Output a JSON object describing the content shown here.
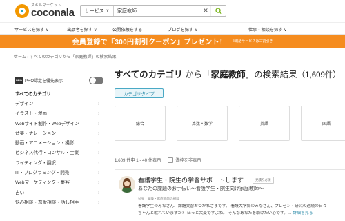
{
  "header": {
    "logo_sub": "スキルマーケット",
    "logo_main": "coconala",
    "search": {
      "category": "サービス",
      "value": "家庭教師"
    }
  },
  "nav": [
    {
      "label": "サービスを探す ∨"
    },
    {
      "label": "出品者を探す ∨"
    },
    {
      "label": "公開依頼をする"
    },
    {
      "label": "ブログを探す ∨"
    },
    {
      "label": "仕事・相談を探す ∨"
    }
  ],
  "banner": {
    "main": "会員登録で『300円割引クーポン』プレゼント！",
    "note": "※電話サービスは二割引き"
  },
  "breadcrumb": "ホーム  ›  すべてのカテゴリから「家庭教師」の検索結果",
  "sidebar": {
    "pro_badge": "PRO",
    "pro_label": "PRO認定を優先表示",
    "all_label": "すべてのカテゴリ",
    "items": [
      {
        "label": "デザイン"
      },
      {
        "label": "イラスト・漫画"
      },
      {
        "label": "Webサイト制作・Webデザイン"
      },
      {
        "label": "音楽・ナレーション"
      },
      {
        "label": "動画・アニメーション・撮影"
      },
      {
        "label": "ビジネス代行・コンサル・士業"
      },
      {
        "label": "ライティング・翻訳"
      },
      {
        "label": "IT・プログラミング・開発"
      },
      {
        "label": "Webマーケティング・集客"
      },
      {
        "label": "占い"
      },
      {
        "label": "悩み相談・恋愛相談・話し相手"
      }
    ]
  },
  "main": {
    "title_pre": "すべてのカテゴリ",
    "title_mid": " から「",
    "title_keyword": "家庭教師",
    "title_post": "」の検索結果",
    "title_count": "（1,609件）",
    "tag_label": "カテゴリタイプ",
    "cards": [
      {
        "label": "総合"
      },
      {
        "label": "算数・数学"
      },
      {
        "label": "英語"
      },
      {
        "label": "国語"
      }
    ],
    "result_count": "1,609 件中 1 - 40 件表示",
    "filter_label": "満枠を非表示"
  },
  "listing": {
    "title": "看護学生・院生の学習サポートします",
    "badge": "見積り必須",
    "subtitle": "あなたの課題のお手伝い〜看護学生・院生向け家庭教師〜",
    "category": "勉強・受験・家庭教師の相談",
    "desc_line1": "看護学生のみなさん、課題実習おつかれさまです。 看護大学院のみなさん、プレゼン・研究の連続の日々",
    "desc_line2": "ちゃんと眠れていますか？ ほっと大変ですよね。 そんなあなたを助けたい心です。…",
    "desc_link": "詳細を見る"
  }
}
